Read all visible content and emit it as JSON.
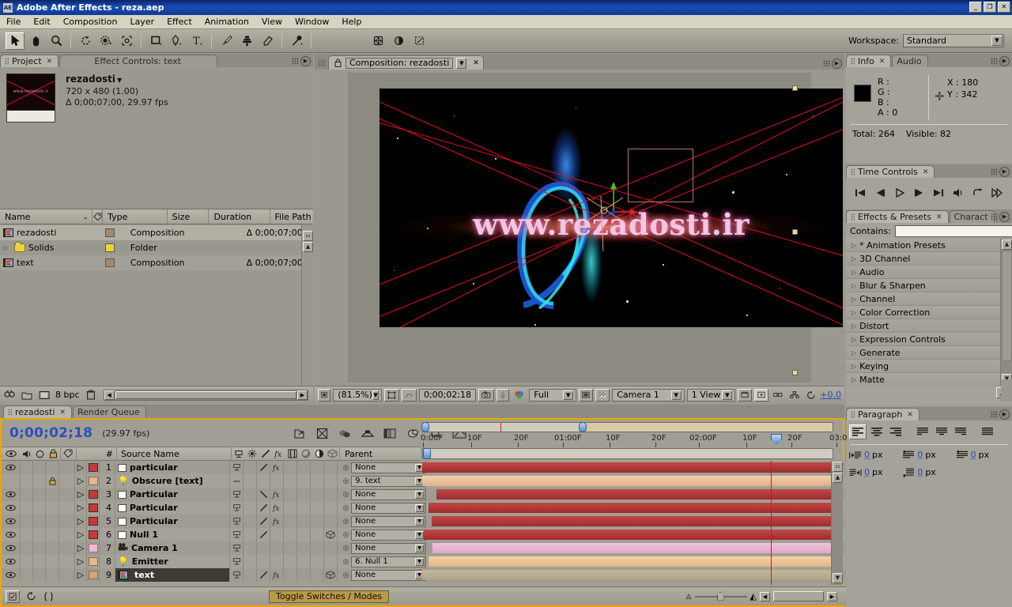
{
  "window": {
    "title": "Adobe After Effects - reza.aep",
    "app_badge": "AE",
    "min": "_",
    "max": "❐",
    "close": "✕"
  },
  "menubar": {
    "items": [
      "File",
      "Edit",
      "Composition",
      "Layer",
      "Effect",
      "Animation",
      "View",
      "Window",
      "Help"
    ]
  },
  "toolbar": {
    "tools": [
      {
        "name": "selection-tool",
        "glyph": "➤",
        "selected": true
      },
      {
        "name": "hand-tool",
        "glyph": "✋",
        "selected": false
      },
      {
        "name": "zoom-tool",
        "glyph": "🔍",
        "selected": false
      },
      {
        "name": "rotation-tool",
        "glyph": "↺",
        "selected": false
      },
      {
        "name": "orbit-camera-tool",
        "glyph": "◐",
        "selected": false
      },
      {
        "name": "pan-behind-tool",
        "glyph": "✥",
        "selected": false
      },
      {
        "name": "shape-tool",
        "glyph": "▭",
        "selected": false
      },
      {
        "name": "pen-tool",
        "glyph": "✒",
        "selected": false
      },
      {
        "name": "text-tool",
        "glyph": "T",
        "selected": false
      },
      {
        "name": "brush-tool",
        "glyph": "🖌",
        "selected": false
      },
      {
        "name": "clone-stamp-tool",
        "glyph": "⌗",
        "selected": false
      },
      {
        "name": "eraser-tool",
        "glyph": "◇",
        "selected": false
      },
      {
        "name": "puppet-pin-tool",
        "glyph": "📌",
        "selected": false
      },
      {
        "name": "anchor-point-tool",
        "glyph": "✜",
        "selected": false
      },
      {
        "name": "mask-tool",
        "glyph": "●",
        "selected": false
      },
      {
        "name": "snapshot-tool",
        "glyph": "⬚",
        "selected": false
      }
    ],
    "workspace_label": "Workspace:",
    "workspace_value": "Standard"
  },
  "project_panel": {
    "tabs": [
      {
        "label": "Project",
        "active": true,
        "closable": true
      },
      {
        "label": "Effect Controls: text",
        "active": false,
        "closable": false
      }
    ],
    "selected_item": {
      "name": "rezadosti",
      "dimensions": "720 x 480 (1.00)",
      "duration_fps": "Δ 0;00;07;00, 29.97 fps",
      "thumb_text": "www.rezadosti.ir"
    },
    "columns": [
      "Name",
      "Type",
      "Size",
      "Duration",
      "File Path"
    ],
    "rows": [
      {
        "name": "rezadosti",
        "icon": "composition-icon",
        "swatch": "#a08a72",
        "type": "Composition",
        "size": "",
        "duration": "Δ 0;00;07;00",
        "selected": true
      },
      {
        "name": "Solids",
        "icon": "folder-icon",
        "swatch": "#ecd43f",
        "type": "Folder",
        "size": "",
        "duration": "",
        "selected": false
      },
      {
        "name": "text",
        "icon": "composition-icon",
        "swatch": "#a08a72",
        "type": "Composition",
        "size": "",
        "duration": "Δ 0;00;07;00",
        "selected": false
      }
    ],
    "footer": {
      "bit_depth": "8 bpc",
      "icons": [
        "find-icon",
        "new-folder-icon",
        "new-composition-icon",
        "delete-icon"
      ]
    }
  },
  "comp_panel": {
    "tab_label": "Composition: rezadosti",
    "viewer": {
      "watermark_text": "www.rezadosti.ir",
      "background": "#000000"
    },
    "toolbar": {
      "magnification": "(81.5%)",
      "current_time": "0;00;02;18",
      "resolution": "Full",
      "camera_view": "Camera 1",
      "view_layout": "1 View",
      "exposure": "+0.0",
      "buttons": [
        "always-preview-this-view-icon",
        "region-of-interest-icon",
        "mask-shape-icon",
        "take-snapshot-icon",
        "show-snapshot-icon",
        "channel-rgb-icon",
        "toggle-transparency-grid-icon",
        "toggle-guides-icon",
        "toggle-3d-view-icon",
        "toggle-pixel-aspect-icon",
        "exposure-reset-icon"
      ]
    }
  },
  "info_panel": {
    "tabs": [
      {
        "label": "Info",
        "active": true
      },
      {
        "label": "Audio",
        "active": false
      }
    ],
    "channels": [
      {
        "label": "R :",
        "value": ""
      },
      {
        "label": "G :",
        "value": ""
      },
      {
        "label": "B :",
        "value": ""
      },
      {
        "label": "A :",
        "value": "0"
      }
    ],
    "coords": [
      {
        "label": "X :",
        "value": "180"
      },
      {
        "label": "Y :",
        "value": "342"
      }
    ],
    "total_label": "Total:",
    "total_value": "264",
    "visible_label": "Visible:",
    "visible_value": "82"
  },
  "time_controls": {
    "tab_label": "Time Controls",
    "buttons": [
      {
        "name": "first-frame-button",
        "glyph": "|◀"
      },
      {
        "name": "previous-frame-button",
        "glyph": "◀|"
      },
      {
        "name": "play-pause-button",
        "glyph": "▶"
      },
      {
        "name": "next-frame-button",
        "glyph": "|▶"
      },
      {
        "name": "last-frame-button",
        "glyph": "▶|"
      },
      {
        "name": "audio-toggle-button",
        "glyph": "◁))"
      },
      {
        "name": "loop-button",
        "glyph": "↷"
      },
      {
        "name": "ram-preview-button",
        "glyph": "▶▶"
      }
    ]
  },
  "effects_panel": {
    "tabs": [
      {
        "label": "Effects & Presets",
        "active": true
      },
      {
        "label": "Charact",
        "active": false
      }
    ],
    "contains_label": "Contains:",
    "contains_value": "",
    "categories": [
      "* Animation Presets",
      "3D Channel",
      "Audio",
      "Blur & Sharpen",
      "Channel",
      "Color Correction",
      "Distort",
      "Expression Controls",
      "Generate",
      "Keying",
      "Matte"
    ]
  },
  "paragraph_panel": {
    "tab_label": "Paragraph",
    "align_buttons": [
      {
        "name": "align-left-button",
        "selected": true
      },
      {
        "name": "align-center-button",
        "selected": false
      },
      {
        "name": "align-right-button",
        "selected": false
      },
      {
        "name": "justify-last-left-button",
        "selected": false
      },
      {
        "name": "justify-last-center-button",
        "selected": false
      },
      {
        "name": "justify-last-right-button",
        "selected": false
      },
      {
        "name": "justify-all-button",
        "selected": false
      }
    ],
    "fields": [
      {
        "name": "indent-left-margin",
        "value": "0",
        "unit": "px"
      },
      {
        "name": "indent-first-line",
        "value": "0",
        "unit": "px"
      },
      {
        "name": "indent-right-margin",
        "value": "0",
        "unit": "px"
      },
      {
        "name": "space-before-paragraph",
        "value": "0",
        "unit": "px"
      },
      {
        "name": "space-after-paragraph",
        "value": "0",
        "unit": "px"
      }
    ]
  },
  "timeline": {
    "tabs": [
      {
        "label": "rezadosti",
        "active": true,
        "closable": true
      },
      {
        "label": "Render Queue",
        "active": false,
        "closable": false
      }
    ],
    "current_time": "0;00;02;18",
    "fps": "(29.97 fps)",
    "toolbar_icons": [
      "composition-mini-flowchart-icon",
      "draft-3d-icon",
      "hide-shy-layers-icon",
      "enable-frame-blending-icon",
      "enable-motion-blur-icon",
      "brainstorm-icon",
      "auto-keyframe-icon",
      "graph-editor-icon"
    ],
    "columns": {
      "av_features": [
        "eye-icon",
        "audio-icon",
        "solo-icon",
        "lock-icon"
      ],
      "shy": "shy-icon",
      "number": "#",
      "source_name": "Source Name",
      "switches": [
        "hide-icon",
        "collapse-transformations-icon",
        "quality-icon",
        "effects-icon",
        "frame-blending-icon",
        "motion-blur-icon",
        "adjustment-layer-icon",
        "3d-layer-icon"
      ],
      "parent": "Parent"
    },
    "ruler_labels": [
      "0:00F",
      "10F",
      "20F",
      "01:00F",
      "10F",
      "20F",
      "02:00F",
      "10F",
      "20F",
      "03:0"
    ],
    "layers": [
      {
        "num": "1",
        "name": "particular",
        "icon": "solid-layer-icon",
        "color": "#c23a3a",
        "bar_color": "#b03434",
        "bar_start": 0,
        "bar_end": 100,
        "parent": "None",
        "visible": true,
        "locked": false,
        "selected": false,
        "has_fx": true,
        "has_quality": true,
        "is3d": false
      },
      {
        "num": "2",
        "name": "Obscure [text]",
        "icon": "light-layer-icon",
        "color": "#e7b78d",
        "bar_color": "#edc19c",
        "bar_start": 0,
        "bar_end": 100,
        "parent": "9. text",
        "visible": false,
        "locked": true,
        "selected": false,
        "has_fx": false,
        "has_quality": false,
        "is3d": false
      },
      {
        "num": "3",
        "name": "Particular",
        "icon": "solid-layer-icon",
        "color": "#c23a3a",
        "bar_color": "#b03434",
        "bar_start": 3.8,
        "bar_end": 100,
        "parent": "None",
        "visible": true,
        "locked": false,
        "selected": false,
        "has_fx": true,
        "has_quality": true,
        "is3d": false
      },
      {
        "num": "4",
        "name": "Particular",
        "icon": "solid-layer-icon",
        "color": "#c23a3a",
        "bar_color": "#b03434",
        "bar_start": 1.4,
        "bar_end": 100,
        "parent": "None",
        "visible": true,
        "locked": false,
        "selected": false,
        "has_fx": true,
        "has_quality": true,
        "is3d": false
      },
      {
        "num": "5",
        "name": "Particular",
        "icon": "solid-layer-icon",
        "color": "#c23a3a",
        "bar_color": "#b03434",
        "bar_start": 2.4,
        "bar_end": 100,
        "parent": "None",
        "visible": true,
        "locked": false,
        "selected": false,
        "has_fx": true,
        "has_quality": true,
        "is3d": false
      },
      {
        "num": "6",
        "name": "Null 1",
        "icon": "solid-layer-icon",
        "color": "#c23a3a",
        "bar_color": "#b03434",
        "bar_start": 0.4,
        "bar_end": 100,
        "parent": "None",
        "visible": true,
        "locked": false,
        "selected": false,
        "has_fx": false,
        "has_quality": true,
        "is3d": true
      },
      {
        "num": "7",
        "name": "Camera 1",
        "icon": "camera-layer-icon",
        "color": "#efb9cf",
        "bar_color": "#e7b4cd",
        "bar_start": 2.6,
        "bar_end": 100,
        "parent": "None",
        "visible": true,
        "locked": false,
        "selected": false,
        "has_fx": false,
        "has_quality": false,
        "is3d": false
      },
      {
        "num": "8",
        "name": "Emitter",
        "icon": "light-layer-icon",
        "color": "#e7b78d",
        "bar_color": "#edc19c",
        "bar_start": 1.4,
        "bar_end": 100,
        "parent": "6. Null 1",
        "visible": true,
        "locked": false,
        "selected": false,
        "has_fx": false,
        "has_quality": false,
        "is3d": false
      },
      {
        "num": "9",
        "name": "text",
        "icon": "composition-layer-icon",
        "color": "#cfa878",
        "bar_color": "#bcb193",
        "bar_start": 0,
        "bar_end": 100,
        "parent": "None",
        "visible": true,
        "locked": false,
        "selected": true,
        "has_fx": true,
        "has_quality": true,
        "is3d": true
      }
    ],
    "toggle_button": "Toggle Switches / Modes"
  }
}
